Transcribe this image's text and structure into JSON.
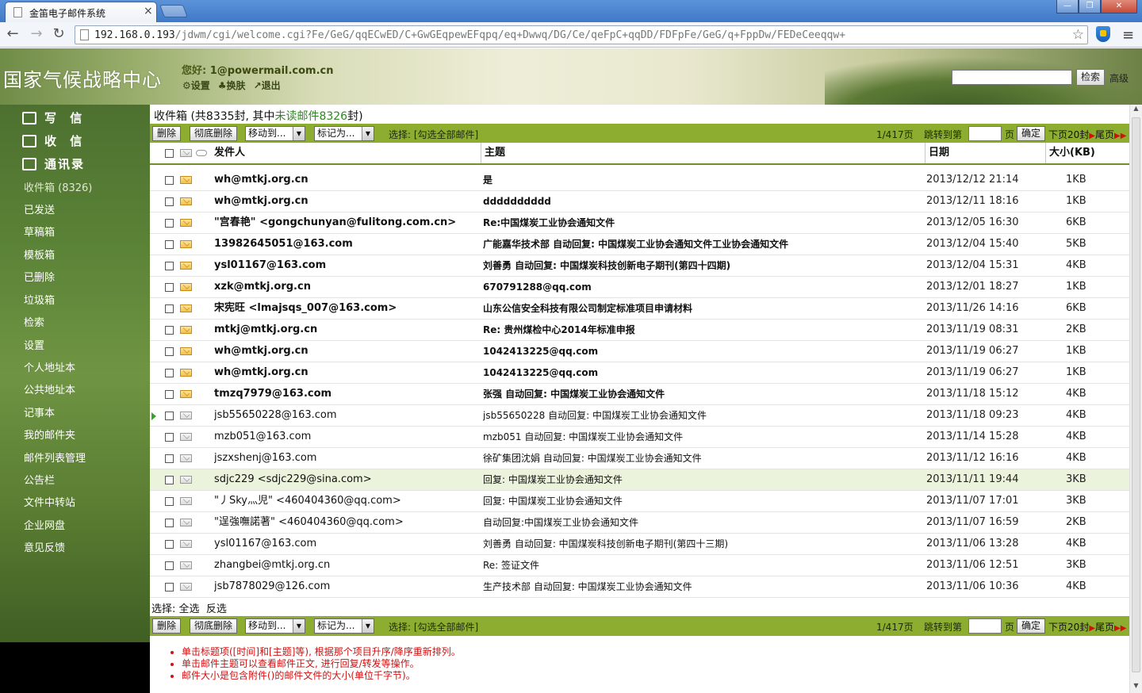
{
  "browser": {
    "tab_title": "金笛电子邮件系统",
    "url_host": "192.168.0.193",
    "url_path": "/jdwm/cgi/welcome.cgi?Fe/GeG/qqECwED/C+GwGEqpewEFqpq/eq+Dwwq/DG/Ce/qeFpC+qqDD/FDFpFe/GeG/q+FppDw/FEDeCeeqqw+"
  },
  "header": {
    "brand": "国家气候战略中心",
    "greeting": "您好:",
    "user_email": "1@powermail.com.cn",
    "links": [
      "设置",
      "换肤",
      "退出"
    ],
    "search_button": "检索",
    "advanced": "高级"
  },
  "sidebar": {
    "main": [
      "写 信",
      "收 信",
      "通讯录"
    ],
    "items": [
      "收件箱 (8326)",
      "已发送",
      "草稿箱",
      "模板箱",
      "已删除",
      "垃圾箱",
      "检索",
      "设置",
      "个人地址本",
      "公共地址本",
      "记事本",
      "我的邮件夹",
      "邮件列表管理",
      "公告栏",
      "文件中转站",
      "企业网盘",
      "意见反馈"
    ]
  },
  "inbox": {
    "title_prefix": "收件箱 (共8335封, 其中",
    "unread_text": "未读邮件8326",
    "title_suffix": "封)"
  },
  "actions": {
    "delete": "删除",
    "purge": "彻底删除",
    "move_to": "移动到...",
    "mark_as": "标记为...",
    "select_label": "选择: [勾选全部邮件]",
    "page_info": "1/417页",
    "jump_label": "跳转到第",
    "page_suffix": "页",
    "confirm": "确定",
    "next_page": "下页20封",
    "last_page": "尾页"
  },
  "columns": {
    "sender": "发件人",
    "subject": "主题",
    "date": "日期",
    "size": "大小(KB)"
  },
  "emails": [
    {
      "sender": "wh@mtkj.org.cn",
      "subject": "是",
      "date": "2013/12/12 21:14",
      "size": "1KB",
      "unread": true
    },
    {
      "sender": "wh@mtkj.org.cn",
      "subject": "dddddddddd",
      "date": "2013/12/11 18:16",
      "size": "1KB",
      "unread": true
    },
    {
      "sender": "\"宫春艳\" <gongchunyan@fulitong.com.cn>",
      "subject": "Re:中国煤炭工业协会通知文件",
      "date": "2013/12/05 16:30",
      "size": "6KB",
      "unread": true
    },
    {
      "sender": "13982645051@163.com",
      "subject": "广能嘉华技术部 自动回复: 中国煤炭工业协会通知文件工业协会通知文件",
      "date": "2013/12/04 15:40",
      "size": "5KB",
      "unread": true
    },
    {
      "sender": "ysl01167@163.com",
      "subject": "刘善勇 自动回复: 中国煤炭科技创新电子期刊(第四十四期)",
      "date": "2013/12/04 15:31",
      "size": "4KB",
      "unread": true
    },
    {
      "sender": "xzk@mtkj.org.cn",
      "subject": "670791288@qq.com",
      "date": "2013/12/01 18:27",
      "size": "1KB",
      "unread": true
    },
    {
      "sender": "宋宪旺 <lmajsqs_007@163.com>",
      "subject": "山东公信安全科技有限公司制定标准项目申请材料",
      "date": "2013/11/26 14:16",
      "size": "6KB",
      "unread": true
    },
    {
      "sender": "mtkj@mtkj.org.cn",
      "subject": "Re: 贵州煤检中心2014年标准申报",
      "date": "2013/11/19 08:31",
      "size": "2KB",
      "unread": true
    },
    {
      "sender": "wh@mtkj.org.cn",
      "subject": "1042413225@qq.com",
      "date": "2013/11/19 06:27",
      "size": "1KB",
      "unread": true
    },
    {
      "sender": "wh@mtkj.org.cn",
      "subject": "1042413225@qq.com",
      "date": "2013/11/19 06:27",
      "size": "1KB",
      "unread": true
    },
    {
      "sender": "tmzq7979@163.com",
      "subject": "张强 自动回复: 中国煤炭工业协会通知文件",
      "date": "2013/11/18 15:12",
      "size": "4KB",
      "unread": true
    },
    {
      "sender": "jsb55650228@163.com",
      "subject": "jsb55650228 自动回复: 中国煤炭工业协会通知文件",
      "date": "2013/11/18 09:23",
      "size": "4KB",
      "unread": false,
      "current": true
    },
    {
      "sender": "mzb051@163.com",
      "subject": "mzb051 自动回复: 中国煤炭工业协会通知文件",
      "date": "2013/11/14 15:28",
      "size": "4KB",
      "unread": false
    },
    {
      "sender": "jszxshenj@163.com",
      "subject": "徐矿集团沈娟 自动回复: 中国煤炭工业协会通知文件",
      "date": "2013/11/12 16:16",
      "size": "4KB",
      "unread": false
    },
    {
      "sender": "sdjc229 <sdjc229@sina.com>",
      "subject": "回复: 中国煤炭工业协会通知文件",
      "date": "2013/11/11 19:44",
      "size": "3KB",
      "unread": false,
      "highlight": true
    },
    {
      "sender": "\"丿Sky灬児\" <460404360@qq.com>",
      "subject": "回复: 中国煤炭工业协会通知文件",
      "date": "2013/11/07 17:01",
      "size": "3KB",
      "unread": false
    },
    {
      "sender": "\"逞強嘸諾著\" <460404360@qq.com>",
      "subject": "自动回复:中国煤炭工业协会通知文件",
      "date": "2013/11/07 16:59",
      "size": "2KB",
      "unread": false
    },
    {
      "sender": "ysl01167@163.com",
      "subject": "刘善勇 自动回复: 中国煤炭科技创新电子期刊(第四十三期)",
      "date": "2013/11/06 13:28",
      "size": "4KB",
      "unread": false
    },
    {
      "sender": "zhangbei@mtkj.org.cn",
      "subject": "Re: 签证文件",
      "date": "2013/11/06 12:51",
      "size": "3KB",
      "unread": false
    },
    {
      "sender": "jsb7878029@126.com",
      "subject": "生产技术部 自动回复: 中国煤炭工业协会通知文件",
      "date": "2013/11/06 10:36",
      "size": "4KB",
      "unread": false
    }
  ],
  "select_line": {
    "label": "选择:",
    "all": "全选",
    "invert": "反选"
  },
  "notes": [
    "单击标题项([时间]和[主题]等), 根据那个项目升序/降序重新排列。",
    "单击邮件主题可以查看邮件正文, 进行回复/转发等操作。",
    "邮件大小是包含附件()的邮件文件的大小(单位千字节)。"
  ],
  "colors": {
    "action_bar": "#8cad2f",
    "unread_accent": "#2c8a1e",
    "note_red": "#d01010"
  }
}
